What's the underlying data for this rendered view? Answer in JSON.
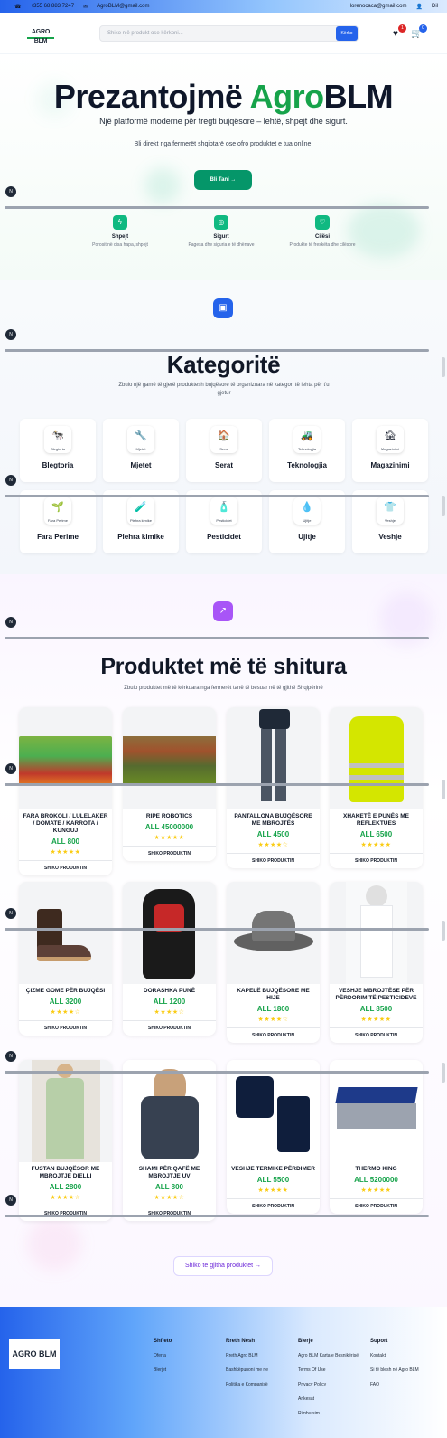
{
  "topbar": {
    "phone": "+355 68 883 7247",
    "email": "AgroBLM@gmail.com",
    "user_email": "lorenocaca@gmail.com",
    "user_short": "Dil"
  },
  "header": {
    "logo": "AGRO BLM",
    "search_placeholder": "Shiko një produkt ose kërkoni...",
    "search_button": "Kërko",
    "wishlist_count": "1",
    "cart_count": "0",
    "colors": {
      "accent": "#2563eb",
      "wishlist_badge": "#dc2626",
      "cart_badge": "#2563eb"
    }
  },
  "hero": {
    "title_part1": "Prezantojmë ",
    "title_green": "Agro",
    "title_part2": "BLM",
    "subtitle": "Një platformë moderne për tregti bujqësore – lehtë, shpejt dhe sigurt.",
    "subtitle2": "Bli direkt nga fermerët shqiptarë ose ofro produktet e tua online.",
    "cta": "Bli Tani →",
    "features": [
      {
        "icon": "bolt-icon",
        "title": "Shpejt",
        "desc": "Porosit në disa hapa, shpejt"
      },
      {
        "icon": "shield-icon",
        "title": "Sigurt",
        "desc": "Pagesa dhe siguria e të dhënave"
      },
      {
        "icon": "heart-icon",
        "title": "Cilësi",
        "desc": "Produkte të freskëta dhe cilësore"
      }
    ]
  },
  "categories": {
    "title": "Kategoritë",
    "subtitle": "Zbulo një gamë të gjerë produktesh bujqësore të organizuara në kategori të lehta për t'u gjetur",
    "items": [
      {
        "name": "Blegtoria",
        "mini": "Blegtoria",
        "glyph": "🐄"
      },
      {
        "name": "Mjetet",
        "mini": "Mjetet",
        "glyph": "🔧"
      },
      {
        "name": "Serat",
        "mini": "Serat",
        "glyph": "🏠"
      },
      {
        "name": "Teknologjia",
        "mini": "Teknologjia",
        "glyph": "🚜"
      },
      {
        "name": "Magazinimi",
        "mini": "Magazinimi",
        "glyph": "🏚"
      },
      {
        "name": "Fara Perime",
        "mini": "Fara Perime",
        "glyph": "🌱"
      },
      {
        "name": "Plehra kimike",
        "mini": "Plehra kimike",
        "glyph": "🧪"
      },
      {
        "name": "Pesticidet",
        "mini": "Pesticidet",
        "glyph": "🧴"
      },
      {
        "name": "Ujitje",
        "mini": "Ujitje",
        "glyph": "💧"
      },
      {
        "name": "Veshje",
        "mini": "Veshje",
        "glyph": "👕"
      }
    ]
  },
  "products": {
    "title": "Produktet më të shitura",
    "subtitle": "Zbulo produktet më të kërkuara nga fermerët tanë të besuar në të gjithë Shqipërinë",
    "view_label": "SHIKO PRODUKTIN",
    "all_button": "Shiko të gjitha produktet →",
    "items": [
      {
        "name": "FARA BROKOLI / LULELAKER / DOMATE / KARROTA / KUNGUJ",
        "price": "ALL 800",
        "stars": "★★★★★",
        "img": "veg"
      },
      {
        "name": "RIPE ROBOTICS",
        "price": "ALL 45000000",
        "stars": "★★★★★",
        "img": "orchard"
      },
      {
        "name": "PANTALLONA BUJQËSORE ME MBROJTËS",
        "price": "ALL 4500",
        "stars": "★★★★☆",
        "img": "pants"
      },
      {
        "name": "XHAKETË E PUNËS ME REFLEKTUES",
        "price": "ALL 6500",
        "stars": "★★★★★",
        "img": "jacket"
      },
      {
        "name": "ÇIZME GOME PËR BUJQËSI",
        "price": "ALL 3200",
        "stars": "★★★★☆",
        "img": "boots"
      },
      {
        "name": "DORASHKA PUNË",
        "price": "ALL 1200",
        "stars": "★★★★☆",
        "img": "gloves"
      },
      {
        "name": "KAPELË BUJQËSORE ME HIJE",
        "price": "ALL 1800",
        "stars": "★★★★☆",
        "img": "hat"
      },
      {
        "name": "VESHJE MBROJTËSE PËR PËRDORIM TË PESTICIDEVE",
        "price": "ALL 8500",
        "stars": "★★★★★",
        "img": "suit"
      },
      {
        "name": "FUSTAN BUJQËSOR ME MBROJTJE DIELLI",
        "price": "ALL 2800",
        "stars": "★★★★☆",
        "img": "dress"
      },
      {
        "name": "SHAMI PËR QAFË ME MBROJTJE UV",
        "price": "ALL 800",
        "stars": "★★★★☆",
        "img": "scarf"
      },
      {
        "name": "VESHJE TERMIKE PËRDIMER",
        "price": "ALL 5500",
        "stars": "★★★★★",
        "img": "thermal"
      },
      {
        "name": "THERMO KING",
        "price": "ALL 5200000",
        "stars": "★★★★★",
        "img": "container"
      }
    ]
  },
  "footer": {
    "logo": "AGRO BLM",
    "columns": [
      {
        "heading": "Shfleto",
        "links": [
          "Oferta",
          "Blerjet"
        ]
      },
      {
        "heading": "Rreth Nesh",
        "links": [
          "Rreth Agro BLM",
          "Bashkëpunoni me ne",
          "Politika e Kompanisë"
        ]
      },
      {
        "heading": "Blerje",
        "links": [
          "Agro BLM Karta e Besnikërisë",
          "Terms Of Use",
          "Privacy Policy",
          "Ankesat",
          "Rimbursim"
        ]
      },
      {
        "heading": "Suport",
        "links": [
          "Kontakt",
          "Si të blesh në Agro BLM",
          "FAQ"
        ]
      }
    ]
  }
}
